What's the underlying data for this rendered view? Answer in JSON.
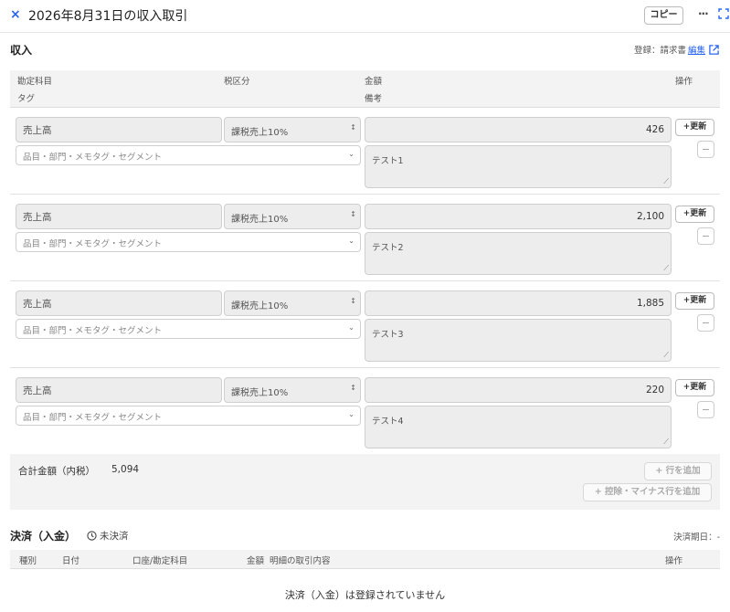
{
  "header": {
    "close_symbol": "×",
    "title": "2026年8月31日の収入取引",
    "copy_label": "コピー",
    "more_symbol": "···"
  },
  "income": {
    "title": "収入",
    "register_label": "登録：請求書",
    "edit_link": "編集"
  },
  "columns": {
    "account": "勘定科目",
    "tax": "税区分",
    "amount": "金額",
    "action": "操作",
    "tag": "タグ",
    "memo": "備考"
  },
  "rows": [
    {
      "account": "売上高",
      "tax": "課税売上10%",
      "amount": "426",
      "tag_placeholder": "品目・部門・メモタグ・セグメント",
      "memo": "テスト1",
      "update_label": "+更新"
    },
    {
      "account": "売上高",
      "tax": "課税売上10%",
      "amount": "2,100",
      "tag_placeholder": "品目・部門・メモタグ・セグメント",
      "memo": "テスト2",
      "update_label": "+更新"
    },
    {
      "account": "売上高",
      "tax": "課税売上10%",
      "amount": "1,885",
      "tag_placeholder": "品目・部門・メモタグ・セグメント",
      "memo": "テスト3",
      "update_label": "+更新"
    },
    {
      "account": "売上高",
      "tax": "課税売上10%",
      "amount": "220",
      "tag_placeholder": "品目・部門・メモタグ・セグメント",
      "memo": "テスト4",
      "update_label": "+更新"
    }
  ],
  "totals": {
    "label": "合計金額（内税）",
    "value": "5,094",
    "add_row": "+ 行を追加",
    "add_minus_row": "+ 控除・マイナス行を追加"
  },
  "payment": {
    "title": "決済（入金）",
    "status": "未決済",
    "due_label": "決済期日：-",
    "columns": {
      "type": "種別",
      "date": "日付",
      "account": "口座/勘定科目",
      "amount": "金額",
      "detail": "明細の取引内容",
      "action": "操作"
    },
    "empty_message": "決済（入金）は登録されていません"
  },
  "colors": {
    "accent": "#2864f0",
    "field_bg": "#ededed",
    "header_bg": "#f3f3f3"
  }
}
